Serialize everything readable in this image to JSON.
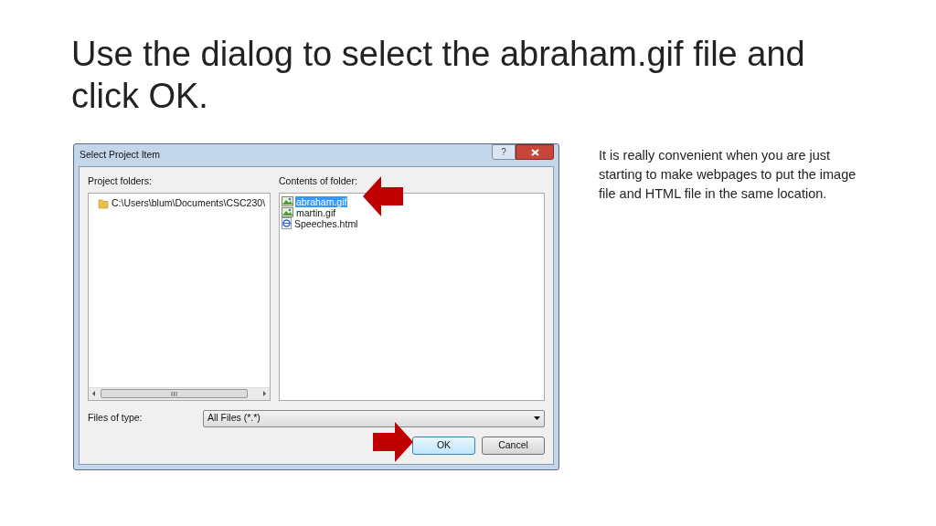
{
  "slide": {
    "title": "Use the dialog to select the abraham.gif file and click OK.",
    "note": "It is really convenient when you are just starting to make webpages to put the image file and HTML file in the same location."
  },
  "dialog": {
    "title": "Select Project Item",
    "help_button": "?",
    "folders_label": "Project folders:",
    "folders": [
      {
        "name": "C:\\Users\\blum\\Documents\\CSC230\\",
        "selected": false
      }
    ],
    "contents_label": "Contents of folder:",
    "files": [
      {
        "name": "abraham.gif",
        "kind": "image",
        "selected": true
      },
      {
        "name": "martin.gif",
        "kind": "image",
        "selected": false
      },
      {
        "name": "Speeches.html",
        "kind": "web",
        "selected": false
      }
    ],
    "type_label": "Files of type:",
    "file_type": "All Files (*.*)",
    "buttons": [
      {
        "label": "OK",
        "default": true
      },
      {
        "label": "Cancel",
        "default": false
      }
    ]
  }
}
